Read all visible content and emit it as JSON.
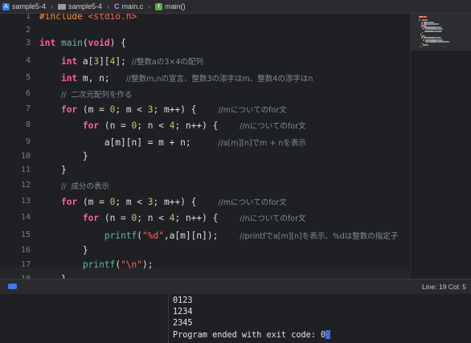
{
  "breadcrumb": {
    "project": "sample5-4",
    "folder": "sample5-4",
    "file": "main.c",
    "symbol": "main()",
    "separator": "›",
    "project_icon_glyph": "A",
    "file_icon_glyph": "C",
    "func_icon_glyph": "f"
  },
  "editor": {
    "line_numbers": [
      "1",
      "2",
      "3",
      "4",
      "5",
      "6",
      "7",
      "8",
      "9",
      "10",
      "11",
      "12",
      "13",
      "14",
      "15",
      "16",
      "17",
      "18",
      "19"
    ],
    "current_line": 19,
    "lines": [
      [
        {
          "t": "#include ",
          "c": "pp"
        },
        {
          "t": "<stdio.h>",
          "c": "ppi"
        }
      ],
      [],
      [
        {
          "t": "int",
          "c": "kw"
        },
        {
          "t": " "
        },
        {
          "t": "main",
          "c": "fn"
        },
        {
          "t": "("
        },
        {
          "t": "void",
          "c": "kw"
        },
        {
          "t": ") {"
        }
      ],
      [
        {
          "t": "    "
        },
        {
          "t": "int",
          "c": "kw"
        },
        {
          "t": " a["
        },
        {
          "t": "3",
          "c": "num"
        },
        {
          "t": "]["
        },
        {
          "t": "4",
          "c": "num"
        },
        {
          "t": "]; "
        },
        {
          "t": "//整数aの3×4の配列",
          "c": "cm"
        }
      ],
      [
        {
          "t": "    "
        },
        {
          "t": "int",
          "c": "kw"
        },
        {
          "t": " m, n;   "
        },
        {
          "t": "//整数m,nの宣言、整数3の添字はm、整数4の添字はn",
          "c": "cm"
        }
      ],
      [
        {
          "t": "    "
        },
        {
          "t": "//  二次元配列を作る",
          "c": "cm"
        }
      ],
      [
        {
          "t": "    "
        },
        {
          "t": "for",
          "c": "kw"
        },
        {
          "t": " (m = "
        },
        {
          "t": "0",
          "c": "num"
        },
        {
          "t": "; m < "
        },
        {
          "t": "3",
          "c": "num"
        },
        {
          "t": "; m++) {    "
        },
        {
          "t": "//mについてのfor文",
          "c": "cm"
        }
      ],
      [
        {
          "t": "        "
        },
        {
          "t": "for",
          "c": "kw"
        },
        {
          "t": " (n = "
        },
        {
          "t": "0",
          "c": "num"
        },
        {
          "t": "; n < "
        },
        {
          "t": "4",
          "c": "num"
        },
        {
          "t": "; n++) {    "
        },
        {
          "t": "//nについてのfor文",
          "c": "cm"
        }
      ],
      [
        {
          "t": "            a[m][n] = m + n;     "
        },
        {
          "t": "//a[m][n]でm + nを表示",
          "c": "cm"
        }
      ],
      [
        {
          "t": "        }"
        }
      ],
      [
        {
          "t": "    }"
        }
      ],
      [
        {
          "t": "    "
        },
        {
          "t": "//  成分の表示",
          "c": "cm"
        }
      ],
      [
        {
          "t": "    "
        },
        {
          "t": "for",
          "c": "kw"
        },
        {
          "t": " (m = "
        },
        {
          "t": "0",
          "c": "num"
        },
        {
          "t": "; m < "
        },
        {
          "t": "3",
          "c": "num"
        },
        {
          "t": "; m++) {    "
        },
        {
          "t": "//mについてのfor文",
          "c": "cm"
        }
      ],
      [
        {
          "t": "        "
        },
        {
          "t": "for",
          "c": "kw"
        },
        {
          "t": " (n = "
        },
        {
          "t": "0",
          "c": "num"
        },
        {
          "t": "; n < "
        },
        {
          "t": "4",
          "c": "num"
        },
        {
          "t": "; n++) {    "
        },
        {
          "t": "//nについてのfor文",
          "c": "cm"
        }
      ],
      [
        {
          "t": "            "
        },
        {
          "t": "printf",
          "c": "fn"
        },
        {
          "t": "("
        },
        {
          "t": "\"%d\"",
          "c": "str"
        },
        {
          "t": ",a[m][n]);    "
        },
        {
          "t": "//printfでa[m][n]を表示、%dは整数の指定子",
          "c": "cm"
        }
      ],
      [
        {
          "t": "        }"
        }
      ],
      [
        {
          "t": "        "
        },
        {
          "t": "printf",
          "c": "fn"
        },
        {
          "t": "("
        },
        {
          "t": "\"\\n\"",
          "c": "str"
        },
        {
          "t": ");"
        }
      ],
      [
        {
          "t": "    }"
        }
      ],
      []
    ]
  },
  "status": {
    "position": "Line: 19  Col: 5"
  },
  "console": {
    "lines": [
      "0123",
      "1234",
      "2345",
      "Program ended with exit code: 0"
    ]
  },
  "colors": {
    "keyword": "#fc5fa3",
    "function": "#67b7a4",
    "number": "#d0bf69",
    "string": "#fc6a5d",
    "comment": "#7f8c98",
    "preprocessor": "#fd8f3f",
    "background": "#1f2024"
  },
  "icons": [
    "project-icon",
    "folder-icon",
    "c-file-icon",
    "function-icon",
    "debug-area-toggle-icon"
  ]
}
